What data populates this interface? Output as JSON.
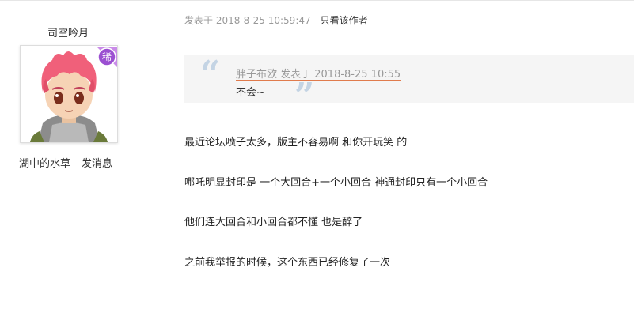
{
  "author": {
    "name": "司空吟月",
    "rank_badge": "稀",
    "rank_badge_color": "#9b4fd1",
    "link_water": "湖中的水草",
    "link_message": "发消息"
  },
  "post_meta": {
    "posted": "发表于 2018-8-25 10:59:47",
    "only_author": "只看该作者"
  },
  "quote": {
    "header": "胖子布欧 发表于 2018-8-25 10:55",
    "text": "不会~",
    "open_mark": "“",
    "close_mark": "”",
    "underline_color": "#e07b4c"
  },
  "body": {
    "lines": [
      "最近论坛喷子太多，版主不容易啊  和你开玩笑 的",
      "哪吒明显封印是 一个大回合+一个小回合   神通封印只有一个小回合",
      "他们连大回合和小回合都不懂 也是醉了",
      "之前我举报的时候，这个东西已经修复了一次"
    ]
  }
}
